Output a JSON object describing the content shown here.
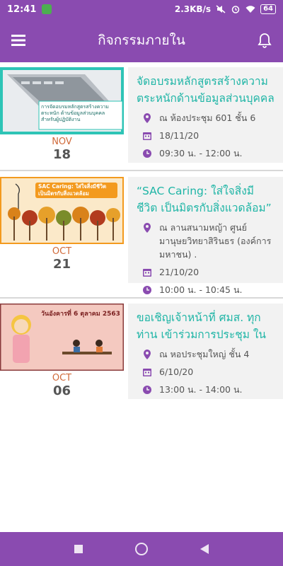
{
  "status": {
    "time": "12:41",
    "net_speed": "2.3KB/s",
    "battery": "64"
  },
  "header": {
    "title": "กิจกรรมภายใน"
  },
  "events": [
    {
      "title": "จัดอบรมหลักสูตรสร้างความตระหนักด้านข้อมูลส่วนบุคคล ...",
      "month": "NOV",
      "day": "18",
      "location": "ณ ห้องประชุม 601 ชั้น 6",
      "date": "18/11/20",
      "time": "09:30 น. - 12:00 น.",
      "thumb_text": "การจัดอบรมหลักสูตรสร้างความตระหนัก ด้านข้อมูลส่วนบุคคล สำหรับผู้ปฏิบัติงาน"
    },
    {
      "title": "“SAC Caring: ใส่ใจสิ่งมีชีวิต เป็นมิตรกับสิ่งแวดล้อม” เชิญชวน...",
      "month": "OCT",
      "day": "21",
      "location": "ณ ลานสนามหญ้า ศูนย์มานุษยวิทยาสิรินธร (องค์การมหาชน) .",
      "date": "21/10/20",
      "time": "10:00 น. - 10:45 น.",
      "thumb_text": "SAC Caring: ใส่ใจสิ่งมีชีวิต เป็นมิตรกับสิ่งแวดล้อม"
    },
    {
      "title": "ขอเชิญเจ้าหน้าที่ ศมส. ทุกท่าน เข้าร่วมการประชุม ในหัวข้...",
      "month": "OCT",
      "day": "06",
      "location": "ณ หอประชุมใหญ่ ชั้น 4",
      "date": "6/10/20",
      "time": "13:00 น. - 14:00 น.",
      "thumb_text": "วันอังคารที่ 6 ตุลาคม 2563"
    }
  ],
  "colors": {
    "primary": "#8a4bb0",
    "accent": "#1fb5a6",
    "month": "#d06a3a"
  },
  "icons": {
    "menu": "menu-icon",
    "bell": "bell-icon",
    "location": "location-pin-icon",
    "date": "calendar-icon",
    "time": "clock-icon"
  }
}
